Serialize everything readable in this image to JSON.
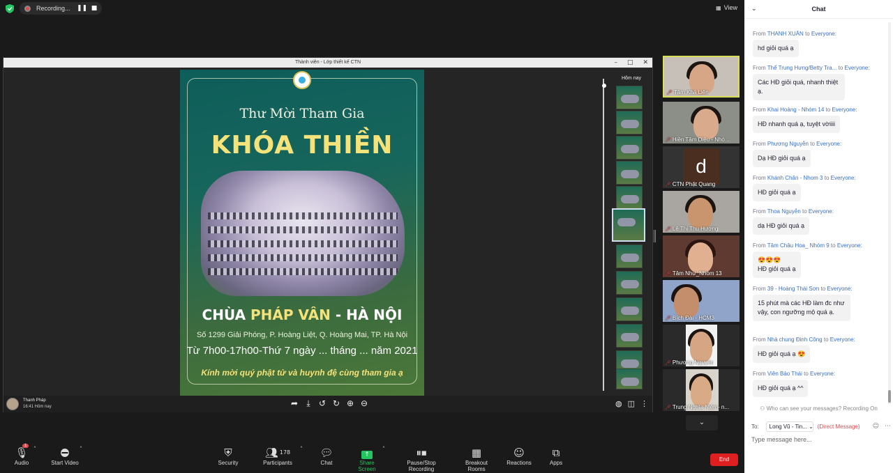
{
  "topbar": {
    "recording_label": "Recording...",
    "pause_icon": "pause-icon",
    "stop_icon": "stop-icon",
    "view_label": "View"
  },
  "share": {
    "window_title": "Thành viên - Lớp thiết kế CTN",
    "thumb_strip_label": "Hôm nay",
    "presenter_name": "Thanh Pháp",
    "presenter_time": "16:41 Hôm nay",
    "poster": {
      "subtitle": "Thư Mời Tham Gia",
      "title": "KHÓA THIỀN",
      "temple_pre": "CHÙA ",
      "temple_highlight": "PHÁP VÂN",
      "temple_post": " - HÀ NỘI",
      "address": "Số 1299 Giải Phóng, P. Hoàng Liệt, Q. Hoàng Mai, TP. Hà Nội",
      "date": "Từ 7h00-17h00-Thứ 7 ngày ... tháng ... năm 2021",
      "invite": "Kính mời quý phật tử và huynh đệ cùng tham gia ạ"
    }
  },
  "gallery": [
    {
      "name": "Tâm Khả Liên",
      "active": true
    },
    {
      "name": "Hiền Tâm Diệu - Nhó..."
    },
    {
      "name": "CTN Phật Quang",
      "letter": "d"
    },
    {
      "name": "Lê Thị Thu Hương"
    },
    {
      "name": "Tâm Như_Nhóm 13"
    },
    {
      "name": "Bích Đài - HCM3"
    },
    {
      "name": "Phương Nguyễn"
    },
    {
      "name": "Trung Nghĩa Niệm- n..."
    }
  ],
  "toolbar": {
    "audio": "Audio",
    "start_video": "Start Video",
    "security": "Security",
    "participants": "Participants",
    "participants_count": "178",
    "chat": "Chat",
    "share_screen": "Share Screen",
    "pause_stop": "Pause/Stop Recording",
    "breakout": "Breakout Rooms",
    "reactions": "Reactions",
    "apps": "Apps",
    "end": "End",
    "audio_badge": "1"
  },
  "chat": {
    "title": "Chat",
    "from_label": "From",
    "to_label": "to",
    "everyone": "Everyone:",
    "messages": [
      {
        "sender": "THANH XUÂN",
        "text": "hd giỏi quá ạ"
      },
      {
        "sender": "Thể Trung Hưng/Betty Tra...",
        "text": "Các HĐ giỏi quá, nhanh thiệt ạ."
      },
      {
        "sender": "Khai Hoàng - Nhóm 14",
        "text": "HĐ nhanh quá ạ, tuyệt vờiiii"
      },
      {
        "sender": "Phương Nguyễn",
        "text": "Dạ HĐ giỏi quá ạ"
      },
      {
        "sender": "Khánh Chân - Nhom 3",
        "text": "HĐ giỏi quá ạ"
      },
      {
        "sender": "Thoa Nguyễn",
        "text": "dạ HĐ giỏi quá ạ"
      },
      {
        "sender": "Tâm Châu Hoa_ Nhóm 9",
        "text": "😍😍😍\nHĐ giỏi quá ạ"
      },
      {
        "sender": "39 - Hoàng Thái Sơn",
        "text": "15 phút mà các HĐ làm đc như vậy, con ngưỡng mộ quá ạ."
      },
      {
        "sender": "Nhà chung Đinh Công",
        "text": "HĐ giỏi quá ạ 😍"
      },
      {
        "sender": "Viên Bảo Thái",
        "text": "HĐ giỏi quá ạ ^^"
      }
    ],
    "privacy_note": "Who can see your messages? Recording On",
    "to_prefix": "To:",
    "to_value": "Long Vũ - Tin...",
    "direct_label": "(Direct Message)",
    "input_placeholder": "Type message here..."
  }
}
